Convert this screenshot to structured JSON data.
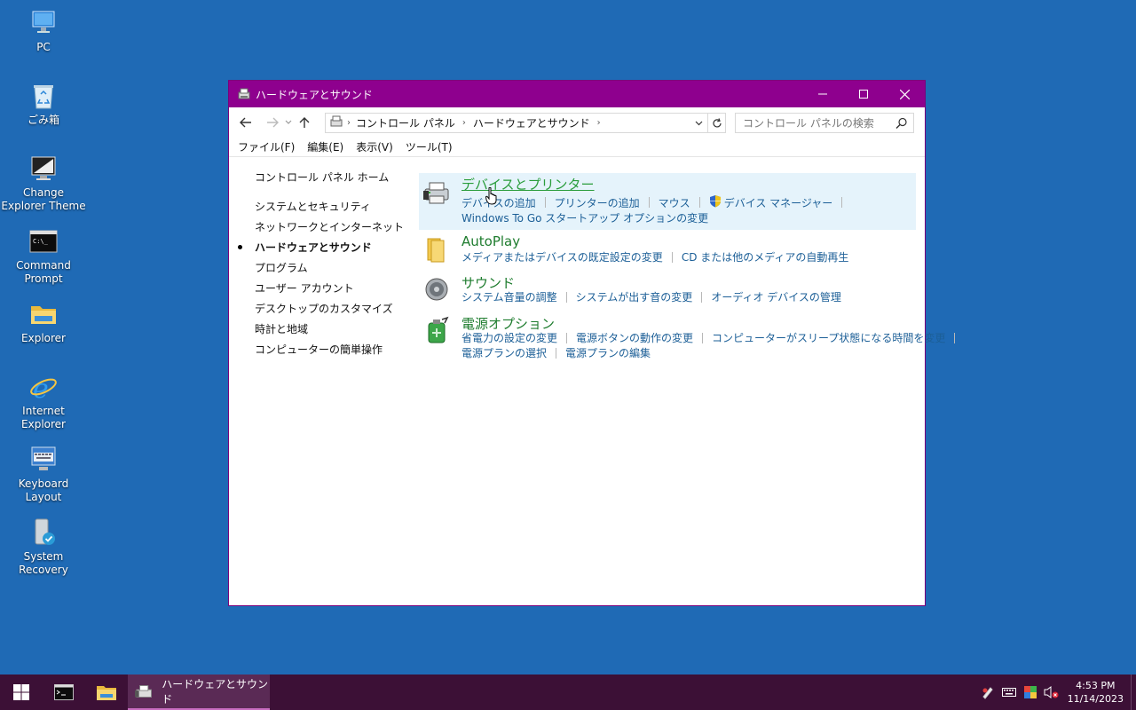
{
  "desktop": {
    "icons": [
      {
        "label": "PC",
        "icon": "pc-icon"
      },
      {
        "label": "ごみ箱",
        "icon": "recycle-bin-icon"
      },
      {
        "label": "Change Explorer Theme",
        "icon": "monitor-icon"
      },
      {
        "label": "Command Prompt",
        "icon": "terminal-icon"
      },
      {
        "label": "Explorer",
        "icon": "folder-icon"
      },
      {
        "label": "Internet Explorer",
        "icon": "ie-icon"
      },
      {
        "label": "Keyboard Layout",
        "icon": "keyboard-icon"
      },
      {
        "label": "System Recovery",
        "icon": "recovery-icon"
      }
    ]
  },
  "window": {
    "title": "ハードウェアとサウンド",
    "minimize": "—",
    "maximize": "☐",
    "close": "✕",
    "address": {
      "crumbs": [
        "コントロール パネル",
        "ハードウェアとサウンド"
      ],
      "separator": "›"
    },
    "search_placeholder": "コントロール パネルの検索",
    "menu": [
      "ファイル(F)",
      "編集(E)",
      "表示(V)",
      "ツール(T)"
    ],
    "left_nav": {
      "home": "コントロール パネル ホーム",
      "items": [
        {
          "label": "システムとセキュリティ",
          "current": false
        },
        {
          "label": "ネットワークとインターネット",
          "current": false
        },
        {
          "label": "ハードウェアとサウンド",
          "current": true
        },
        {
          "label": "プログラム",
          "current": false
        },
        {
          "label": "ユーザー アカウント",
          "current": false
        },
        {
          "label": "デスクトップのカスタマイズ",
          "current": false
        },
        {
          "label": "時計と地域",
          "current": false
        },
        {
          "label": "コンピューターの簡単操作",
          "current": false
        }
      ]
    },
    "categories": [
      {
        "title": "デバイスとプリンター",
        "icon": "printer-icon",
        "links_row1": [
          "デバイスの追加",
          "プリンターの追加",
          "マウス",
          "デバイス マネージャー"
        ],
        "links_row2": [
          "Windows To Go スタートアップ オプションの変更"
        ]
      },
      {
        "title": "AutoPlay",
        "icon": "autoplay-icon",
        "links_row1": [
          "メディアまたはデバイスの既定設定の変更",
          "CD または他のメディアの自動再生"
        ],
        "links_row2": []
      },
      {
        "title": "サウンド",
        "icon": "speaker-icon",
        "links_row1": [
          "システム音量の調整",
          "システムが出す音の変更",
          "オーディオ デバイスの管理"
        ],
        "links_row2": []
      },
      {
        "title": "電源オプション",
        "icon": "power-options-icon",
        "links_row1": [
          "省電力の設定の変更",
          "電源ボタンの動作の変更",
          "コンピューターがスリープ状態になる時間を変更"
        ],
        "links_row2": [
          "電源プランの選択",
          "電源プランの編集"
        ]
      }
    ]
  },
  "taskbar": {
    "active_window_label": "ハードウェアとサウンド",
    "clock_time": "4:53 PM",
    "clock_date": "11/14/2023"
  },
  "colors": {
    "desktop": "#1f6ab5",
    "titlebar": "#8e008e",
    "taskbar": "#3c1036",
    "category_title": "#1e7c2e",
    "link": "#1c5f97"
  }
}
